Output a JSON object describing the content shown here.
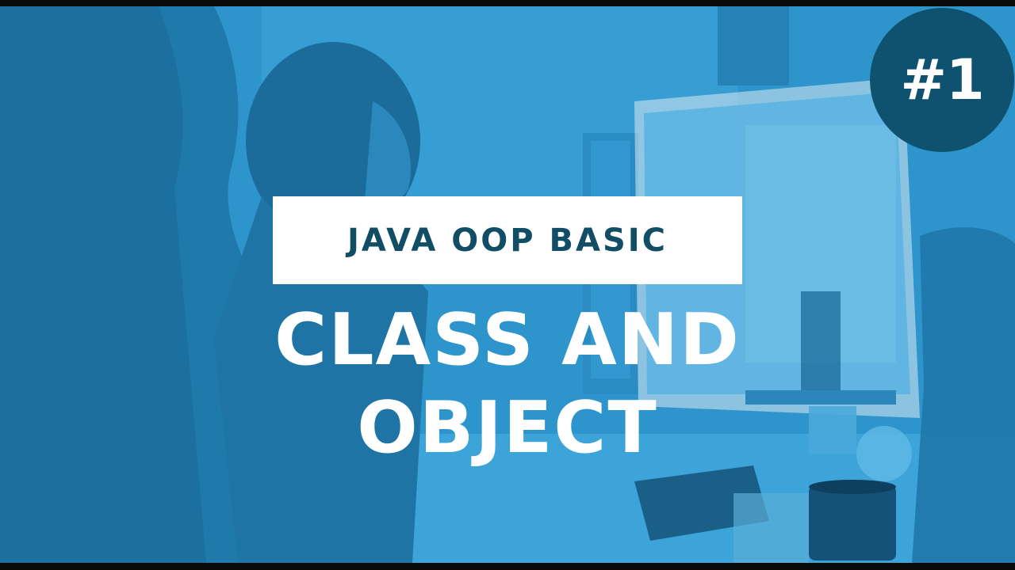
{
  "thumbnail": {
    "subtitle": "JAVA OOP BASIC",
    "title_line_1": "CLASS AND",
    "title_line_2": "OBJECT",
    "episode": "#1"
  },
  "colors": {
    "overlay_blue": "#2b92c9",
    "dark_blue": "#0e5270",
    "subtitle_text": "#124d66",
    "white": "#ffffff"
  },
  "background": {
    "description_icon": "office-photo-people-at-computer"
  }
}
